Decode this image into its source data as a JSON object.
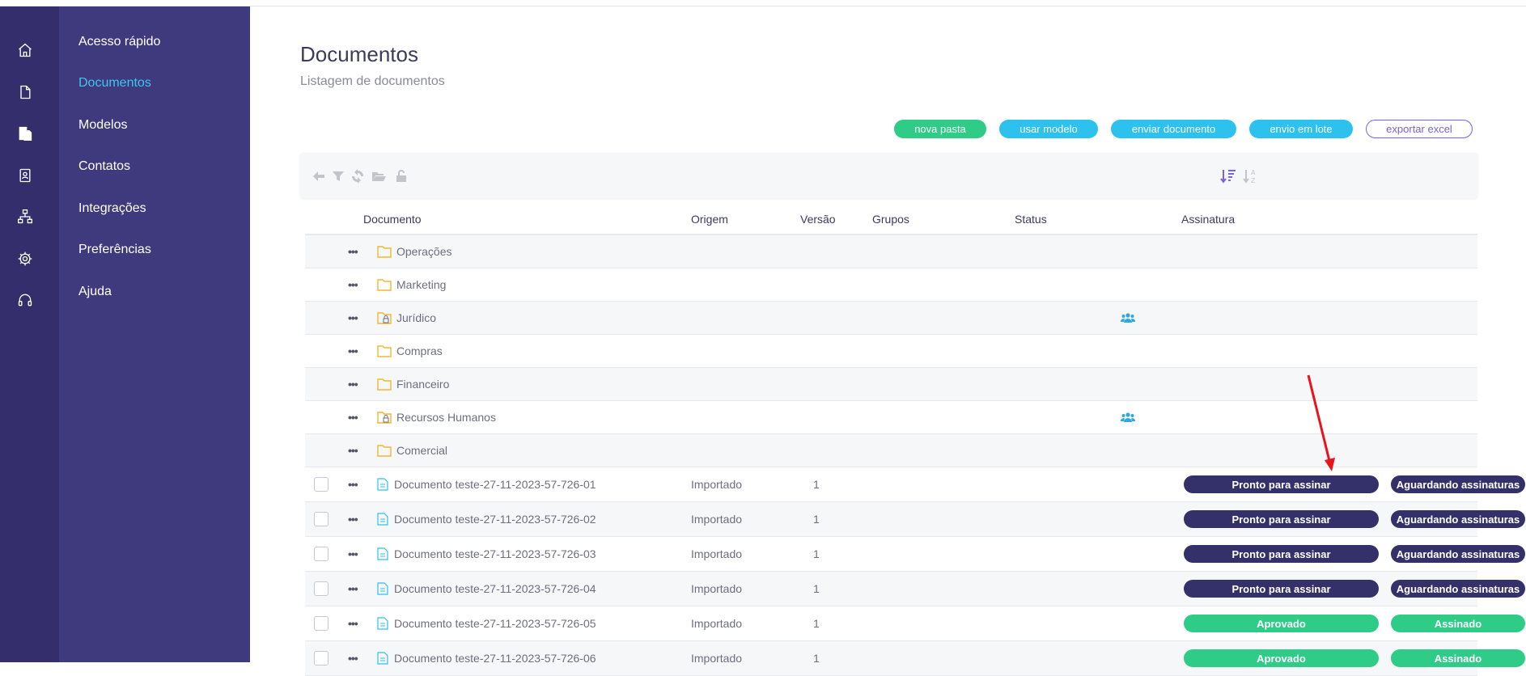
{
  "sidebar": {
    "items": [
      {
        "label": "Acesso rápido",
        "icon": "home-icon"
      },
      {
        "label": "Documentos",
        "icon": "document-icon"
      },
      {
        "label": "Modelos",
        "icon": "templates-icon"
      },
      {
        "label": "Contatos",
        "icon": "contacts-icon"
      },
      {
        "label": "Integrações",
        "icon": "integrations-icon"
      },
      {
        "label": "Preferências",
        "icon": "gear-icon"
      },
      {
        "label": "Ajuda",
        "icon": "headset-icon"
      }
    ],
    "active_color": "#3cc6ee"
  },
  "page": {
    "title": "Documentos",
    "subtitle": "Listagem de documentos"
  },
  "actions": {
    "nova_pasta": "nova pasta",
    "usar_modelo": "usar modelo",
    "enviar_documento": "enviar documento",
    "envio_em_lote": "envio em lote",
    "exportar_excel": "exportar excel"
  },
  "table": {
    "headers": {
      "documento": "Documento",
      "origem": "Origem",
      "versao": "Versão",
      "grupos": "Grupos",
      "status": "Status",
      "assinatura": "Assinatura"
    },
    "folders": [
      {
        "name": "Operações",
        "locked": false,
        "has_groups": false
      },
      {
        "name": "Marketing",
        "locked": false,
        "has_groups": false
      },
      {
        "name": "Jurídico",
        "locked": true,
        "has_groups": true
      },
      {
        "name": "Compras",
        "locked": false,
        "has_groups": false
      },
      {
        "name": "Financeiro",
        "locked": false,
        "has_groups": false
      },
      {
        "name": "Recursos Humanos",
        "locked": true,
        "has_groups": true
      },
      {
        "name": "Comercial",
        "locked": false,
        "has_groups": false
      }
    ],
    "documents": [
      {
        "name": "Documento teste-27-11-2023-57-726-01",
        "origem": "Importado",
        "versao": "1",
        "status": "Pronto para assinar",
        "assinatura": "Aguardando assinaturas"
      },
      {
        "name": "Documento teste-27-11-2023-57-726-02",
        "origem": "Importado",
        "versao": "1",
        "status": "Pronto para assinar",
        "assinatura": "Aguardando assinaturas"
      },
      {
        "name": "Documento teste-27-11-2023-57-726-03",
        "origem": "Importado",
        "versao": "1",
        "status": "Pronto para assinar",
        "assinatura": "Aguardando assinaturas"
      },
      {
        "name": "Documento teste-27-11-2023-57-726-04",
        "origem": "Importado",
        "versao": "1",
        "status": "Pronto para assinar",
        "assinatura": "Aguardando assinaturas"
      },
      {
        "name": "Documento teste-27-11-2023-57-726-05",
        "origem": "Importado",
        "versao": "1",
        "status": "Aprovado",
        "assinatura": "Assinado"
      },
      {
        "name": "Documento teste-27-11-2023-57-726-06",
        "origem": "Importado",
        "versao": "1",
        "status": "Aprovado",
        "assinatura": "Assinado"
      }
    ]
  },
  "colors": {
    "rail": "#342e6c",
    "nav": "#3f3a7e",
    "green": "#2ecc87",
    "cyan": "#2dc2ee",
    "dark_badge": "#33306a",
    "annotation_arrow": "#e8141c"
  }
}
